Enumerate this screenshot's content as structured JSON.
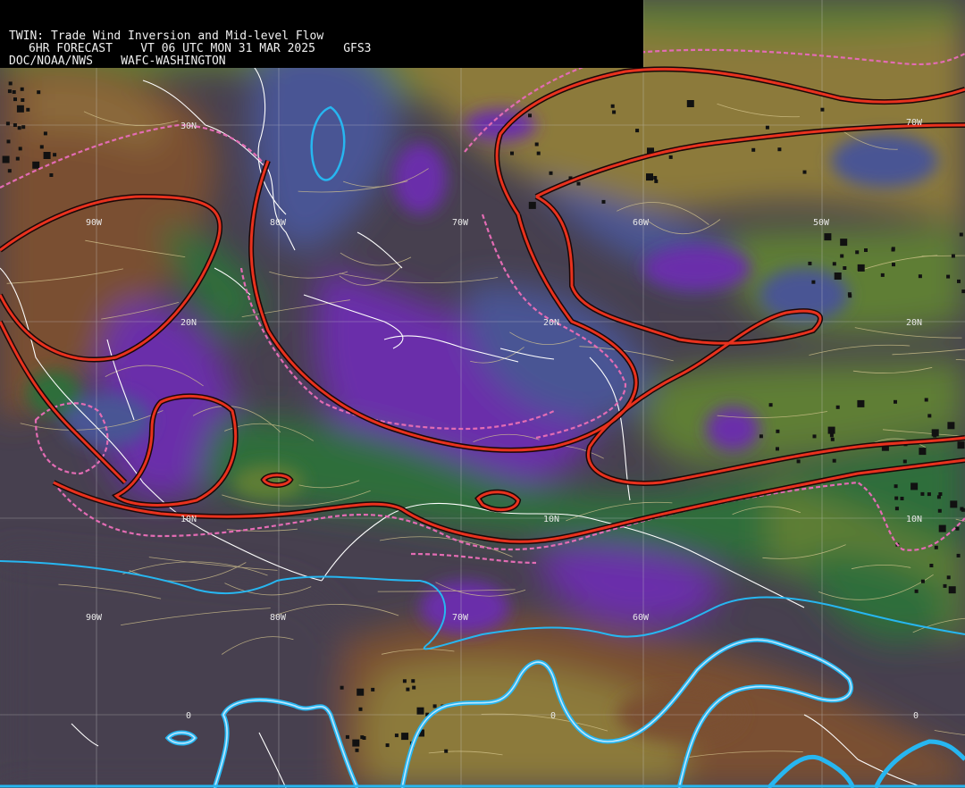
{
  "header": {
    "title": "TWIN: Trade Wind Inversion and Mid-level Flow",
    "forecast_line": "6HR FORECAST    VT 06 UTC MON 31 MAR 2025    GFS3",
    "agency_line": "DOC/NOAA/NWS    WAFC-WASHINGTON"
  },
  "grid_labels": {
    "lon_top": [
      "90W",
      "80W",
      "70W",
      "60W",
      "50W"
    ],
    "lon_bottom": [
      "90W",
      "80W",
      "70W",
      "60W"
    ],
    "lat_right": [
      "20N",
      "10N",
      "0"
    ],
    "lat_left": [
      "30N",
      "20N",
      "10N",
      "0"
    ],
    "lat_mid": [
      "20N",
      "10N",
      "0"
    ],
    "extra": [
      "70W"
    ]
  },
  "colors": {
    "background": "#47404f",
    "dark_purple": "#47404f",
    "slate_blue": "#4a5494",
    "violet": "#6a2eaa",
    "dark_green": "#2f6e3a",
    "olive_green": "#5f7e36",
    "brown": "#7a5030",
    "ochre": "#8c7a3a",
    "contour_red": "#e8321e",
    "contour_black": "#1a0808",
    "dashed_pink": "#e36cb4",
    "contour_blue": "#27b6f0",
    "streamline": "#d8c890",
    "coastline": "#ffffff"
  }
}
